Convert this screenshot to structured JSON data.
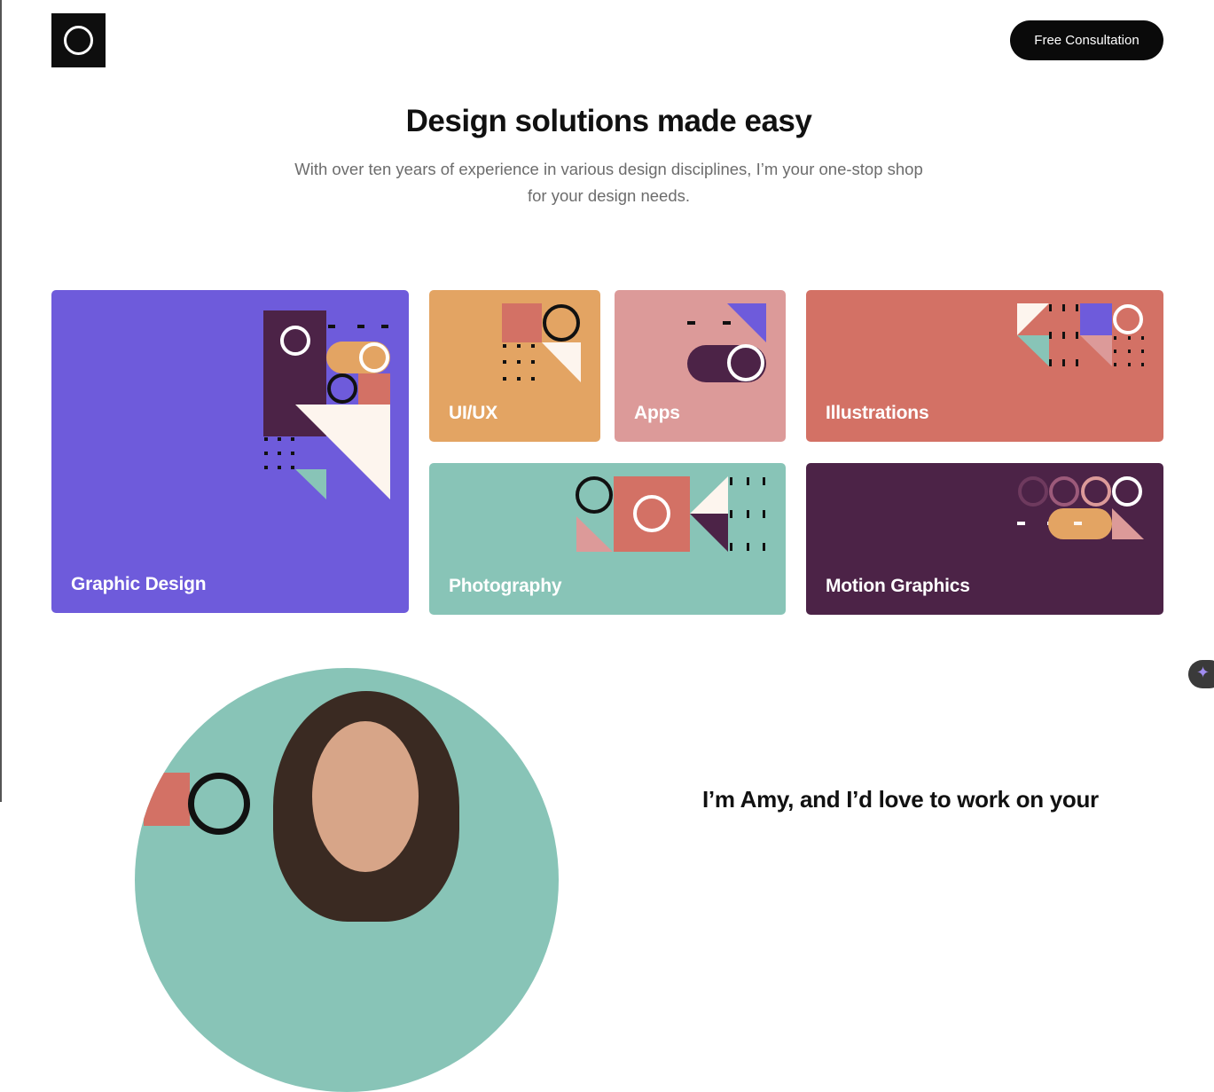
{
  "header": {
    "logo_name": "ring-logo",
    "cta_label": "Free Consultation"
  },
  "hero": {
    "title": "Design solutions made easy",
    "subtitle": "With over ten years of experience in various design disciplines, I’m your one-stop shop for your design needs."
  },
  "services": [
    {
      "label": "Graphic Design",
      "color": "#6e5bdb"
    },
    {
      "label": "UI/UX",
      "color": "#e3a463"
    },
    {
      "label": "Apps",
      "color": "#dc9a99"
    },
    {
      "label": "Illustrations",
      "color": "#d37165"
    },
    {
      "label": "Photography",
      "color": "#88c4b7"
    },
    {
      "label": "Motion Graphics",
      "color": "#4c2347"
    }
  ],
  "about": {
    "title": "I’m Amy, and I’d love to work on your"
  },
  "colors": {
    "purple": "#6e5bdb",
    "orange": "#e3a463",
    "pink": "#dc9a99",
    "coral": "#d37165",
    "teal": "#88c4b7",
    "plum": "#4c2347",
    "cream": "#fdf5ee"
  },
  "assistant_fab_icon": "sparkle-icon"
}
